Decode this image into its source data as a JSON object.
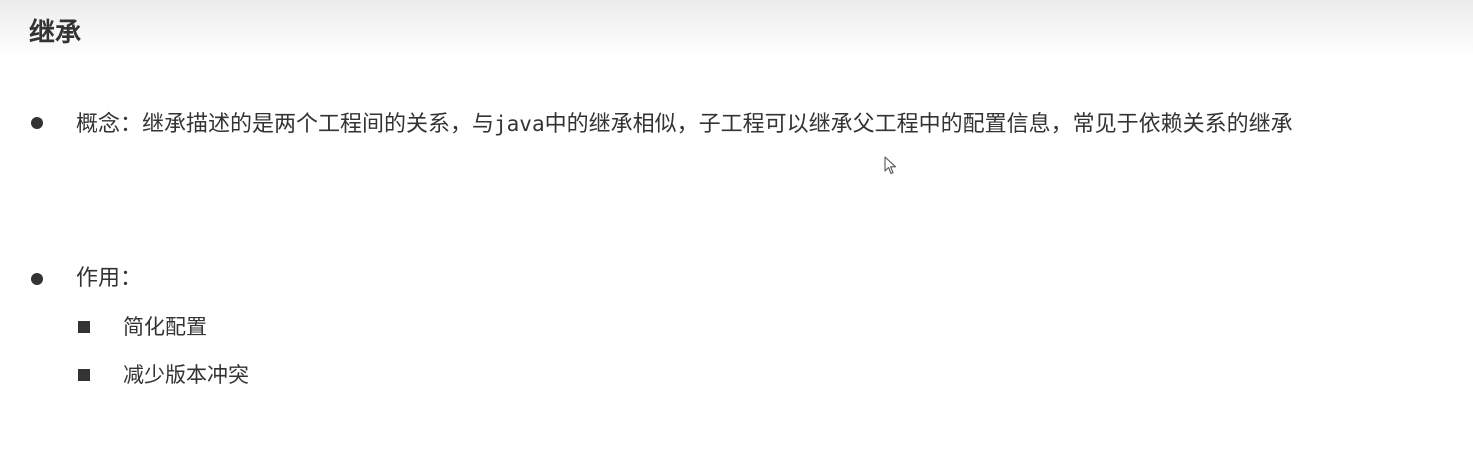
{
  "header": {
    "title": "继承"
  },
  "concept": {
    "before_code": "概念：继承描述的是两个工程间的关系，与",
    "code": "java",
    "after_code": "中的继承相似，子工程可以继承父工程中的配置信息，常见于依赖关系的继承"
  },
  "usage": {
    "label": "作用：",
    "items": [
      "简化配置",
      "减少版本冲突"
    ]
  },
  "icons": {
    "cursor": "mouse-pointer-icon"
  }
}
